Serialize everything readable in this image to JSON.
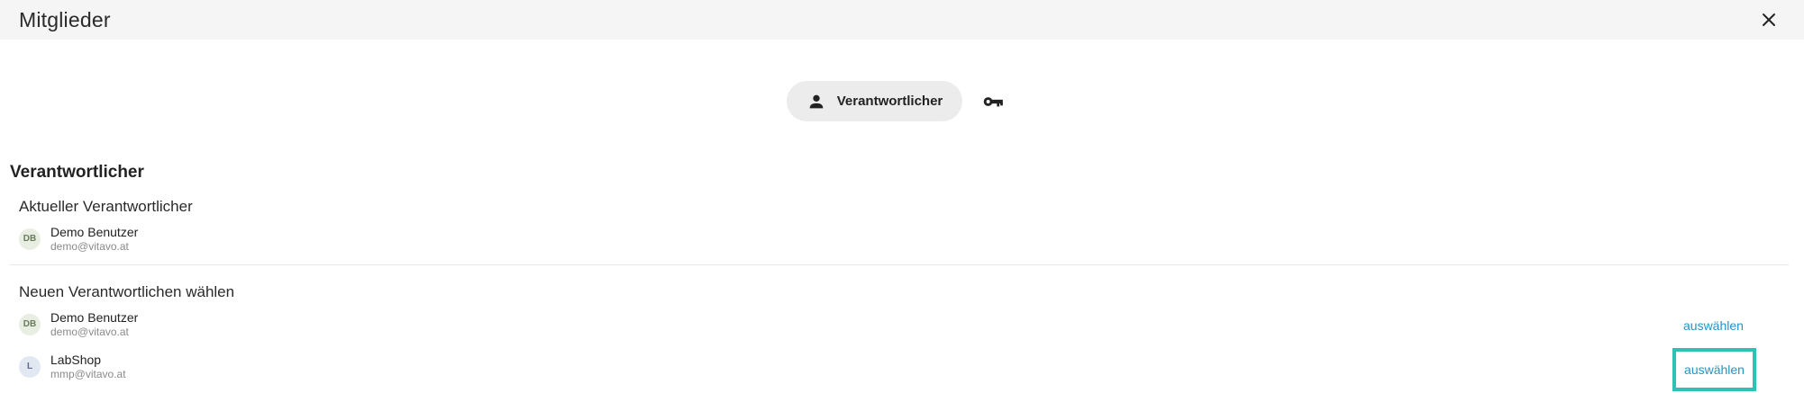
{
  "header": {
    "title": "Mitglieder"
  },
  "tabs": {
    "active_label": "Verantwortlicher"
  },
  "section": {
    "title": "Verantwortlicher",
    "current_label": "Aktueller Verantwortlicher",
    "choose_label": "Neuen Verantwortlichen wählen"
  },
  "current": {
    "initials": "DB",
    "name": "Demo Benutzer",
    "email": "demo@vitavo.at"
  },
  "candidates": [
    {
      "initials": "DB",
      "name": "Demo Benutzer",
      "email": "demo@vitavo.at",
      "action": "auswählen"
    },
    {
      "initials": "L",
      "name": "LabShop",
      "email": "mmp@vitavo.at",
      "action": "auswählen"
    }
  ],
  "colors": {
    "link": "#2196c9",
    "focus": "#2ec2b4",
    "header_bg": "#f5f5f5"
  }
}
